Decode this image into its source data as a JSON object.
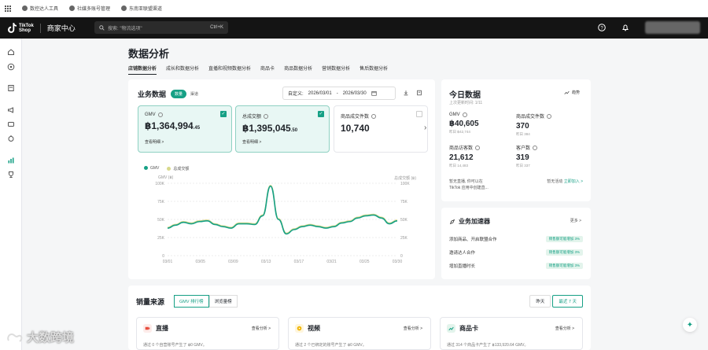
{
  "bookmarks": [
    "数控达人工具",
    "社媒多账号管理",
    "东南亚联盟渠道"
  ],
  "header": {
    "logo_line1": "TikTok",
    "logo_line2": "Shop",
    "center": "商家中心",
    "search_placeholder": "搜索: \"物流选项\"",
    "search_shortcut": "Ctrl+K"
  },
  "page": {
    "title": "数据分析",
    "tabs": [
      "店铺数据分析",
      "成长和数据分析",
      "直播和视频数据分析",
      "商品卡",
      "商品数据分析",
      "营销数据分析",
      "售后数据分析"
    ]
  },
  "business": {
    "title": "业务数据",
    "toggle_on": "数量",
    "toggle_off": "渠道",
    "date_label": "自定义:",
    "date_start": "2026/03/01",
    "date_sep": "-",
    "date_end": "2026/03/30",
    "metrics": [
      {
        "label": "GMV",
        "value": "฿1,364,994",
        "decimals": ".45",
        "link": "查看明细 >"
      },
      {
        "label": "总成交额",
        "value": "฿1,395,045",
        "decimals": ".50",
        "link": "查看明细 >"
      },
      {
        "label": "商品成交件数",
        "value": "10,740",
        "decimals": "",
        "link": ""
      }
    ]
  },
  "chart_data": {
    "type": "line",
    "legend": [
      "GMV",
      "总成交额"
    ],
    "left_axis_title": "GMV (฿)",
    "right_axis_title": "总成交额 (฿)",
    "y_ticks_left": [
      "100K",
      "75K",
      "50K",
      "25K",
      "0"
    ],
    "y_ticks_right": [
      "100K",
      "75K",
      "50K",
      "25K",
      "0"
    ],
    "x_ticks": [
      "03/01",
      "03/05",
      "03/09",
      "03/13",
      "03/17",
      "03/21",
      "03/25",
      "03/30"
    ],
    "ylim": [
      0,
      100000
    ],
    "series": [
      {
        "name": "GMV",
        "color": "#16a085",
        "values": [
          38000,
          42000,
          46000,
          44000,
          47000,
          48000,
          43000,
          40000,
          38000,
          44000,
          44000,
          43000,
          55000,
          96000,
          50000,
          30000,
          36000,
          40000,
          42000,
          40000,
          38000,
          40000,
          45000,
          47000,
          52000,
          55000,
          56000,
          52000,
          44000,
          48000
        ]
      },
      {
        "name": "总成交额",
        "color": "#d8d98b",
        "values": [
          39000,
          43000,
          47000,
          45000,
          48000,
          49000,
          44000,
          41000,
          39000,
          45000,
          45000,
          44000,
          56000,
          97000,
          51000,
          31000,
          37000,
          41000,
          43000,
          41000,
          39000,
          41000,
          46000,
          48000,
          53000,
          56000,
          57000,
          53000,
          45000,
          49000
        ]
      }
    ]
  },
  "today": {
    "title": "今日数据",
    "subtitle": "上次更新时间: 1/11",
    "trend_link": "趋势",
    "tiles": [
      {
        "label": "GMV",
        "value": "฿40,605",
        "compare": "昨日 ฿42,744"
      },
      {
        "label": "商品成交件数",
        "value": "370",
        "compare": "昨日 384"
      },
      {
        "label": "商品访客数",
        "value": "21,612",
        "compare": "昨日 14,483"
      },
      {
        "label": "客户数",
        "value": "319",
        "compare": "昨日 337"
      }
    ],
    "live_text_1": "暂无直播, 你可以在",
    "live_text_2": "TikTok 应用中创建直...",
    "activity_text": "暂无活动",
    "activity_link": "立即加入 >"
  },
  "accelerator": {
    "title": "业务加速器",
    "more": "更多 >",
    "rows": [
      {
        "label": "添加商品、开启联盟合作",
        "tag": "销售额可能增加 3%"
      },
      {
        "label": "邀请达人合作",
        "tag": "销售额可能增加 3%"
      },
      {
        "label": "增加直播时长",
        "tag": "销售额可能增加 3%"
      }
    ]
  },
  "sales": {
    "title": "销量来源",
    "tab_on": "GMV 排行榜",
    "tab_off": "浏览量榜",
    "range_1": "昨天",
    "range_2": "最近 7 天",
    "cards": [
      {
        "title": "直播",
        "link": "查看分析 >",
        "desc": "通过 0 个自营账号产生了 ฿0 GMV。",
        "color": "#e74c3c"
      },
      {
        "title": "视频",
        "link": "查看分析 >",
        "desc": "通过 2 个已绑定的账号产生了 ฿0 GMV。",
        "color": "#f0b400"
      },
      {
        "title": "商品卡",
        "link": "查看分析 >",
        "desc": "通过 314 个商品卡产生了 ฿133,920.64 GMV。",
        "color": "#16a085"
      }
    ]
  },
  "watermark": "大数跨境"
}
